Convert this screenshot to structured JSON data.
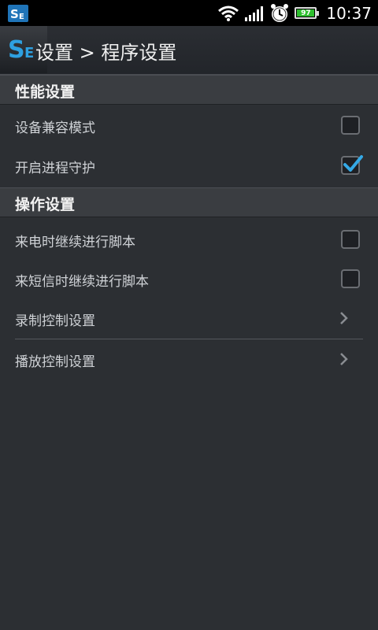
{
  "status_bar": {
    "time": "10:37",
    "battery_level": "97",
    "icons": [
      "app-icon",
      "wifi-icon",
      "signal-icon",
      "alarm-icon",
      "battery-icon"
    ]
  },
  "header": {
    "title": "设置 > 程序设置"
  },
  "sections": [
    {
      "label": "性能设置",
      "items": [
        {
          "label": "设备兼容模式",
          "control": "checkbox",
          "checked": false
        },
        {
          "label": "开启进程守护",
          "control": "checkbox",
          "checked": true
        }
      ]
    },
    {
      "label": "操作设置",
      "items": [
        {
          "label": "来电时继续进行脚本",
          "control": "checkbox",
          "checked": false
        },
        {
          "label": "来短信时继续进行脚本",
          "control": "checkbox",
          "checked": false
        },
        {
          "label": "录制控制设置",
          "control": "chevron"
        },
        {
          "label": "播放控制设置",
          "control": "chevron"
        }
      ]
    }
  ],
  "colors": {
    "accent": "#35a9e6",
    "background": "#2c2f33"
  }
}
